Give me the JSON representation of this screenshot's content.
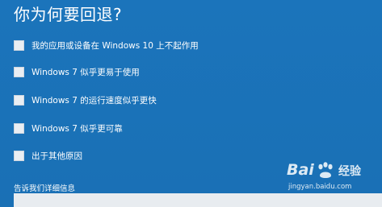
{
  "dialog": {
    "title": "你为何要回退?",
    "options": [
      {
        "label": "我的应用或设备在 Windows 10 上不起作用",
        "checked": false
      },
      {
        "label": "Windows 7 似乎更易于使用",
        "checked": false
      },
      {
        "label": "Windows 7 的运行速度似乎更快",
        "checked": false
      },
      {
        "label": "Windows 7 似乎更可靠",
        "checked": false
      },
      {
        "label": "出于其他原因",
        "checked": false
      }
    ],
    "details_label": "告诉我们详细信息",
    "details_value": ""
  },
  "watermark": {
    "logo_left": "Bai",
    "logo_right": "经验",
    "url": "jingyan.baidu.com"
  },
  "colors": {
    "background": "#1a72b8",
    "checkbox": "#e9eef3",
    "input": "#e8ecf0"
  }
}
